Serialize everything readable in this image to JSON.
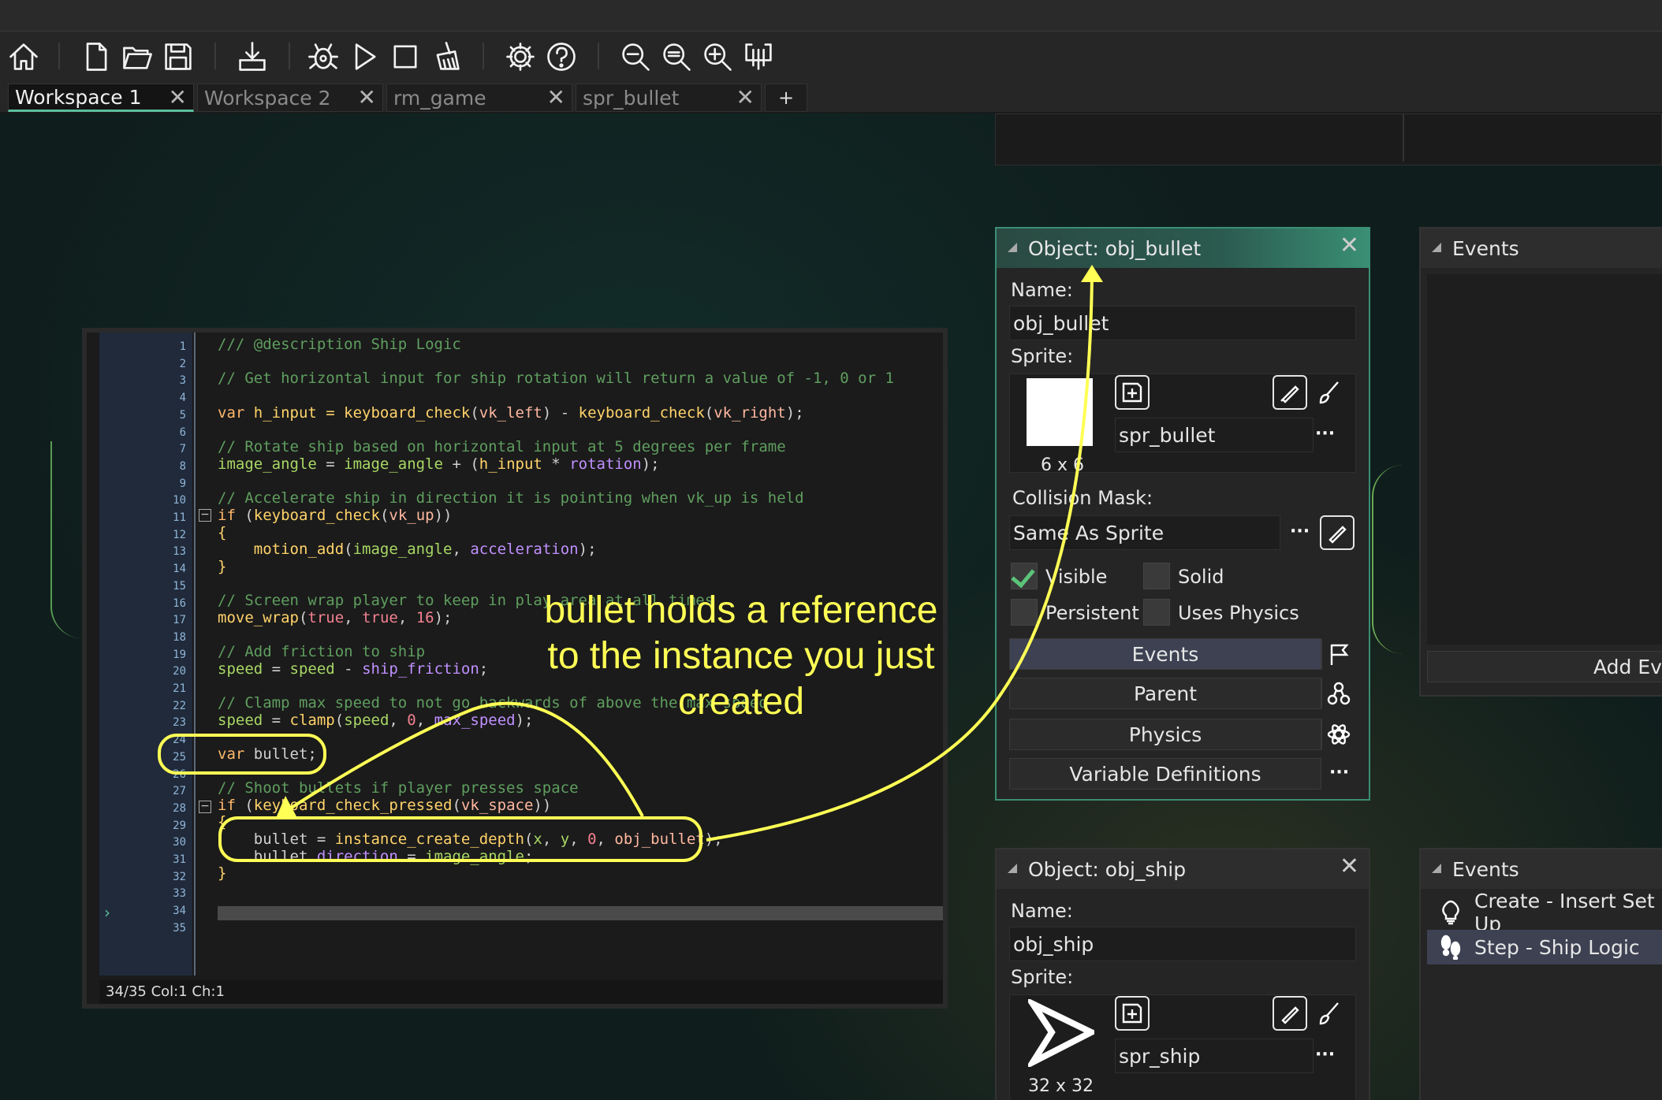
{
  "toolbar": {
    "icons": [
      "home-icon",
      "new-file-icon",
      "open-folder-icon",
      "save-icon",
      "export-icon",
      "debug-icon",
      "run-icon",
      "stop-icon",
      "clean-icon",
      "settings-icon",
      "help-icon",
      "zoom-out-icon",
      "zoom-reset-icon",
      "zoom-in-icon",
      "workspace-layout-icon"
    ]
  },
  "tabs": [
    {
      "label": "Workspace 1",
      "active": true
    },
    {
      "label": "Workspace 2"
    },
    {
      "label": "rm_game"
    },
    {
      "label": "spr_bullet"
    },
    {
      "label": "+"
    }
  ],
  "code": {
    "lines": [
      "1",
      "2",
      "3",
      "4",
      "5",
      "6",
      "7",
      "8",
      "9",
      "10",
      "11",
      "12",
      "13",
      "14",
      "15",
      "16",
      "17",
      "18",
      "19",
      "20",
      "21",
      "22",
      "23",
      "24",
      "25",
      "26",
      "27",
      "28",
      "29",
      "30",
      "31",
      "32",
      "33",
      "34",
      "35"
    ],
    "l1": "/// @description Ship Logic",
    "l3": "// Get horizontal input for ship rotation will return a value of -1, 0 or 1",
    "l5a": "var",
    "l5b": " h_input = ",
    "l5c": "keyboard_check",
    "l5d": "(",
    "l5e": "vk_left",
    "l5f": ") - ",
    "l5g": "keyboard_check",
    "l5h": "(",
    "l5i": "vk_right",
    "l5j": ");",
    "l7": "// Rotate ship based on horizontal input at 5 degrees per frame",
    "l8a": "image_angle",
    "l8b": " = ",
    "l8c": "image_angle",
    "l8d": " + (",
    "l8e": "h_input",
    "l8f": " * ",
    "l8g": "rotation",
    "l8h": ");",
    "l10": "// Accelerate ship in direction it is pointing when vk_up is held",
    "l11a": "if",
    "l11b": " (",
    "l11c": "keyboard_check",
    "l11d": "(",
    "l11e": "vk_up",
    "l11f": "))",
    "l12": "{",
    "l13a": "    motion_add",
    "l13b": "(",
    "l13c": "image_angle",
    "l13d": ", ",
    "l13e": "acceleration",
    "l13f": ");",
    "l14": "}",
    "l16": "// Screen wrap player to keep in play area at all times",
    "l17a": "move_wrap",
    "l17b": "(",
    "l17c": "true",
    "l17d": ", ",
    "l17e": "true",
    "l17f": ", ",
    "l17g": "16",
    "l17h": ");",
    "l19": "// Add friction to ship",
    "l20a": "speed",
    "l20b": " = ",
    "l20c": "speed",
    "l20d": " - ",
    "l20e": "ship_friction",
    "l20f": ";",
    "l22": "// Clamp max speed to not go backwards of above the max speed",
    "l23a": "speed",
    "l23b": " = ",
    "l23c": "clamp",
    "l23d": "(",
    "l23e": "speed",
    "l23f": ", ",
    "l23g": "0",
    "l23h": ", ",
    "l23i": "max_speed",
    "l23j": ");",
    "l25a": "var",
    "l25b": " bullet;",
    "l27": "// Shoot bullets if player presses space",
    "l28a": "if",
    "l28b": " (",
    "l28c": "keyboard_check_pressed",
    "l28d": "(",
    "l28e": "vk_space",
    "l28f": "))",
    "l29": "{",
    "l30a": "    bullet = ",
    "l30b": "instance_create_depth",
    "l30c": "(",
    "l30d": "x",
    "l30e": ", ",
    "l30f": "y",
    "l30g": ", ",
    "l30h": "0",
    "l30i": ", ",
    "l30j": "obj_bullet",
    "l30k": ");",
    "l31a": "    bullet.",
    "l31b": "direction",
    "l31c": " = ",
    "l31d": "image_angle",
    "l31e": ";",
    "l32": "}",
    "status": "34/35 Col:1 Ch:1"
  },
  "annotation": {
    "text": "bullet holds a reference to the instance you just created",
    "color": "#ffff55"
  },
  "bullet_panel": {
    "title": "Object: obj_bullet",
    "name_label": "Name:",
    "name_value": "obj_bullet",
    "sprite_label": "Sprite:",
    "sprite_name": "spr_bullet",
    "sprite_size": "6 x 6",
    "mask_label": "Collision Mask:",
    "mask_value": "Same As Sprite",
    "visible": "Visible",
    "solid": "Solid",
    "persistent": "Persistent",
    "uses_physics": "Uses Physics",
    "events_btn": "Events",
    "parent_btn": "Parent",
    "physics_btn": "Physics",
    "vardefs_btn": "Variable Definitions",
    "dots": "···"
  },
  "events_panel_1": {
    "title": "Events",
    "add_event": "Add Event"
  },
  "ship_panel": {
    "title": "Object: obj_ship",
    "name_label": "Name:",
    "name_value": "obj_ship",
    "sprite_label": "Sprite:",
    "sprite_name": "spr_ship",
    "sprite_size": "32 x 32",
    "dots": "···"
  },
  "events_panel_2": {
    "title": "Events",
    "items": [
      {
        "label": "Create - Insert Set Up",
        "icon": "lightbulb-icon"
      },
      {
        "label": "Step - Ship Logic",
        "icon": "footsteps-icon"
      }
    ]
  },
  "colors": {
    "accent": "#3a8f74",
    "annotation": "#ffff55",
    "background": "#0f1e1c"
  }
}
